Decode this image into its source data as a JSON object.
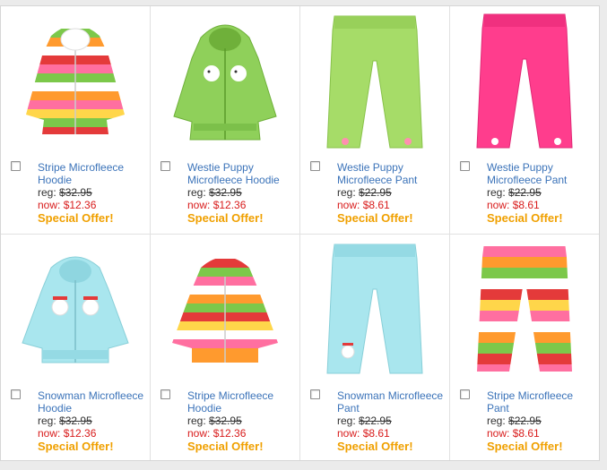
{
  "products": [
    {
      "name": "Stripe Microfleece Hoodie",
      "reg_label": "reg: ",
      "reg_price": "$32.95",
      "now_label": "now: ",
      "now_price": "$12.36",
      "offer": "Special Offer!"
    },
    {
      "name": "Westie Puppy Microfleece Hoodie",
      "reg_label": "reg: ",
      "reg_price": "$32.95",
      "now_label": "now: ",
      "now_price": "$12.36",
      "offer": "Special Offer!"
    },
    {
      "name": "Westie Puppy Microfleece Pant",
      "reg_label": "reg: ",
      "reg_price": "$22.95",
      "now_label": "now: ",
      "now_price": "$8.61",
      "offer": "Special Offer!"
    },
    {
      "name": "Westie Puppy Microfleece Pant",
      "reg_label": "reg: ",
      "reg_price": "$22.95",
      "now_label": "now: ",
      "now_price": "$8.61",
      "offer": "Special Offer!"
    },
    {
      "name": "Snowman Microfleece Hoodie",
      "reg_label": "reg: ",
      "reg_price": "$32.95",
      "now_label": "now: ",
      "now_price": "$12.36",
      "offer": "Special Offer!"
    },
    {
      "name": "Stripe Microfleece Hoodie",
      "reg_label": "reg: ",
      "reg_price": "$32.95",
      "now_label": "now: ",
      "now_price": "$12.36",
      "offer": "Special Offer!"
    },
    {
      "name": "Snowman Microfleece Pant",
      "reg_label": "reg: ",
      "reg_price": "$22.95",
      "now_label": "now: ",
      "now_price": "$8.61",
      "offer": "Special Offer!"
    },
    {
      "name": "Stripe Microfleece Pant",
      "reg_label": "reg: ",
      "reg_price": "$22.95",
      "now_label": "now: ",
      "now_price": "$8.61",
      "offer": "Special Offer!"
    }
  ],
  "colors": {
    "link": "#3b73b9",
    "sale_price": "#d81b1b",
    "special_offer": "#f0a000",
    "stripe_pink": "#ff6fa0",
    "stripe_green": "#7cc84a",
    "stripe_orange": "#ff9a2e",
    "stripe_red": "#e43a3a",
    "stripe_white": "#ffffff",
    "stripe_yellow": "#ffd64a",
    "puppy_green": "#8fd05a",
    "pant_green": "#a6dc68",
    "pant_pink": "#ff3d8d",
    "snow_blue": "#a9e6ee"
  },
  "icons": {
    "checkbox": "checkbox-icon",
    "thumbnails": [
      "stripe-hoodie-image",
      "westie-puppy-hoodie-image",
      "green-pant-image",
      "pink-pant-image",
      "snowman-hoodie-image",
      "stripe-hoodie-image",
      "snowman-pant-image",
      "stripe-pant-image"
    ]
  }
}
